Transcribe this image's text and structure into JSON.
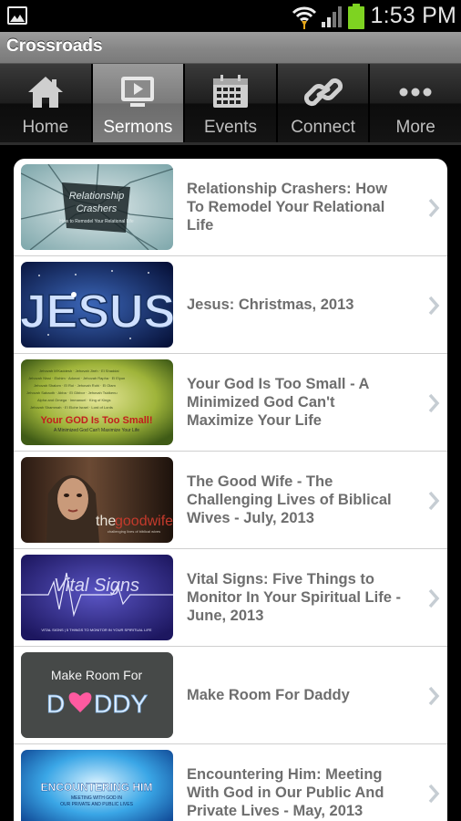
{
  "status_bar": {
    "time": "1:53 PM",
    "icons": [
      "gallery-icon",
      "wifi-icon",
      "signal-icon",
      "battery-icon"
    ],
    "battery_color": "#7ed321"
  },
  "app": {
    "title": "Crossroads"
  },
  "tabs": [
    {
      "label": "Home",
      "icon": "home-icon",
      "active": false
    },
    {
      "label": "Sermons",
      "icon": "monitor-play-icon",
      "active": true
    },
    {
      "label": "Events",
      "icon": "calendar-icon",
      "active": false
    },
    {
      "label": "Connect",
      "icon": "chain-link-icon",
      "active": false
    },
    {
      "label": "More",
      "icon": "more-dots-icon",
      "active": false
    }
  ],
  "sermons": [
    {
      "title": "Relationship Crashers: How To Remodel Your Relational Life",
      "thumb_text": [
        "Relationship",
        "Crashers",
        "How to Remodel Your Relational Life"
      ]
    },
    {
      "title": "Jesus: Christmas, 2013",
      "thumb_text": [
        "JESUS"
      ]
    },
    {
      "title": "Your God Is Too Small - A Minimized God Can't Maximize Your Life",
      "thumb_text": [
        "Your GOD Is Too Small!",
        "A Minimized God Can't Maximize Your Life"
      ]
    },
    {
      "title": "The Good Wife - The Challenging Lives of Biblical Wives - July, 2013",
      "thumb_text": [
        "the",
        "goodwife",
        "challenging lives of biblical wives"
      ]
    },
    {
      "title": "Vital Signs: Five Things to Monitor In Your Spiritual Life - June, 2013",
      "thumb_text": [
        "Vital Signs",
        "VITAL SIGNS | 5 THINGS TO MONITOR IN YOUR SPIRITUAL LIFE"
      ]
    },
    {
      "title": "Make Room For Daddy",
      "thumb_text": [
        "Make Room For",
        "D",
        "DDY"
      ]
    },
    {
      "title": "Encountering Him: Meeting With God in Our Public And Private Lives - May, 2013",
      "thumb_text": [
        "ENCOUNTERING HIM",
        "MEETING WITH GOD IN",
        "OUR PRIVATE AND PUBLIC LIVES"
      ]
    }
  ],
  "colors": {
    "accent": "#7d7d7d",
    "text": "#6e6e6e",
    "chevron": "#c6cdd3"
  }
}
